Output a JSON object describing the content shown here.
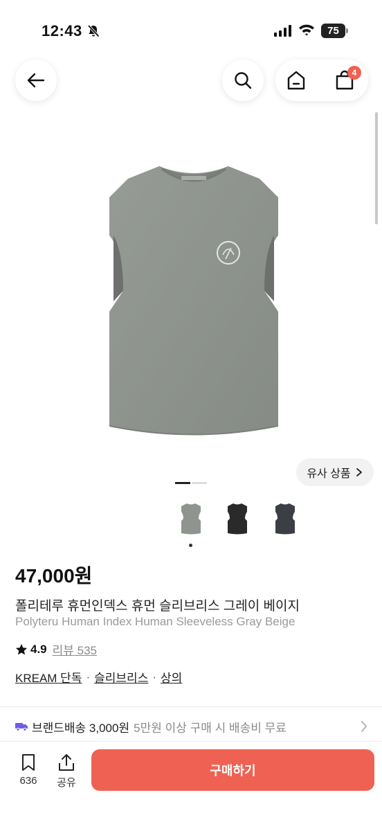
{
  "status_bar": {
    "time": "12:43",
    "battery": "75"
  },
  "header": {
    "cart_badge": "4"
  },
  "gallery": {
    "similar_label": "유사 상품"
  },
  "product": {
    "price": "47,000원",
    "name_ko": "폴리테루 휴먼인덱스 휴먼 슬리브리스 그레이 베이지",
    "name_en": "Polyteru Human Index Human Sleeveless Gray Beige",
    "rating": "4.9",
    "review_label": "리뷰 535",
    "tags": [
      "KREAM 단독",
      "슬리브리스",
      "상의"
    ],
    "tag_separator": "·"
  },
  "shipping": {
    "title": "브랜드배송 3,000원",
    "note": "5만원 이상 구매 시 배송비 무료"
  },
  "bottom_bar": {
    "save_count": "636",
    "share_label": "공유",
    "buy_label": "구매하기"
  },
  "colors": {
    "accent": "#ef6253",
    "shipping_icon": "#6c5ce7",
    "product_gray": "#8f948f",
    "product_black": "#2a2a2a",
    "product_charcoal": "#3b3f45"
  },
  "icons": [
    "bell-slash-icon",
    "signal-icon",
    "wifi-icon",
    "battery-icon",
    "back-arrow-icon",
    "search-icon",
    "home-icon",
    "shopping-bag-icon",
    "chevron-right-icon",
    "star-icon",
    "truck-icon",
    "bookmark-icon",
    "share-icon"
  ]
}
